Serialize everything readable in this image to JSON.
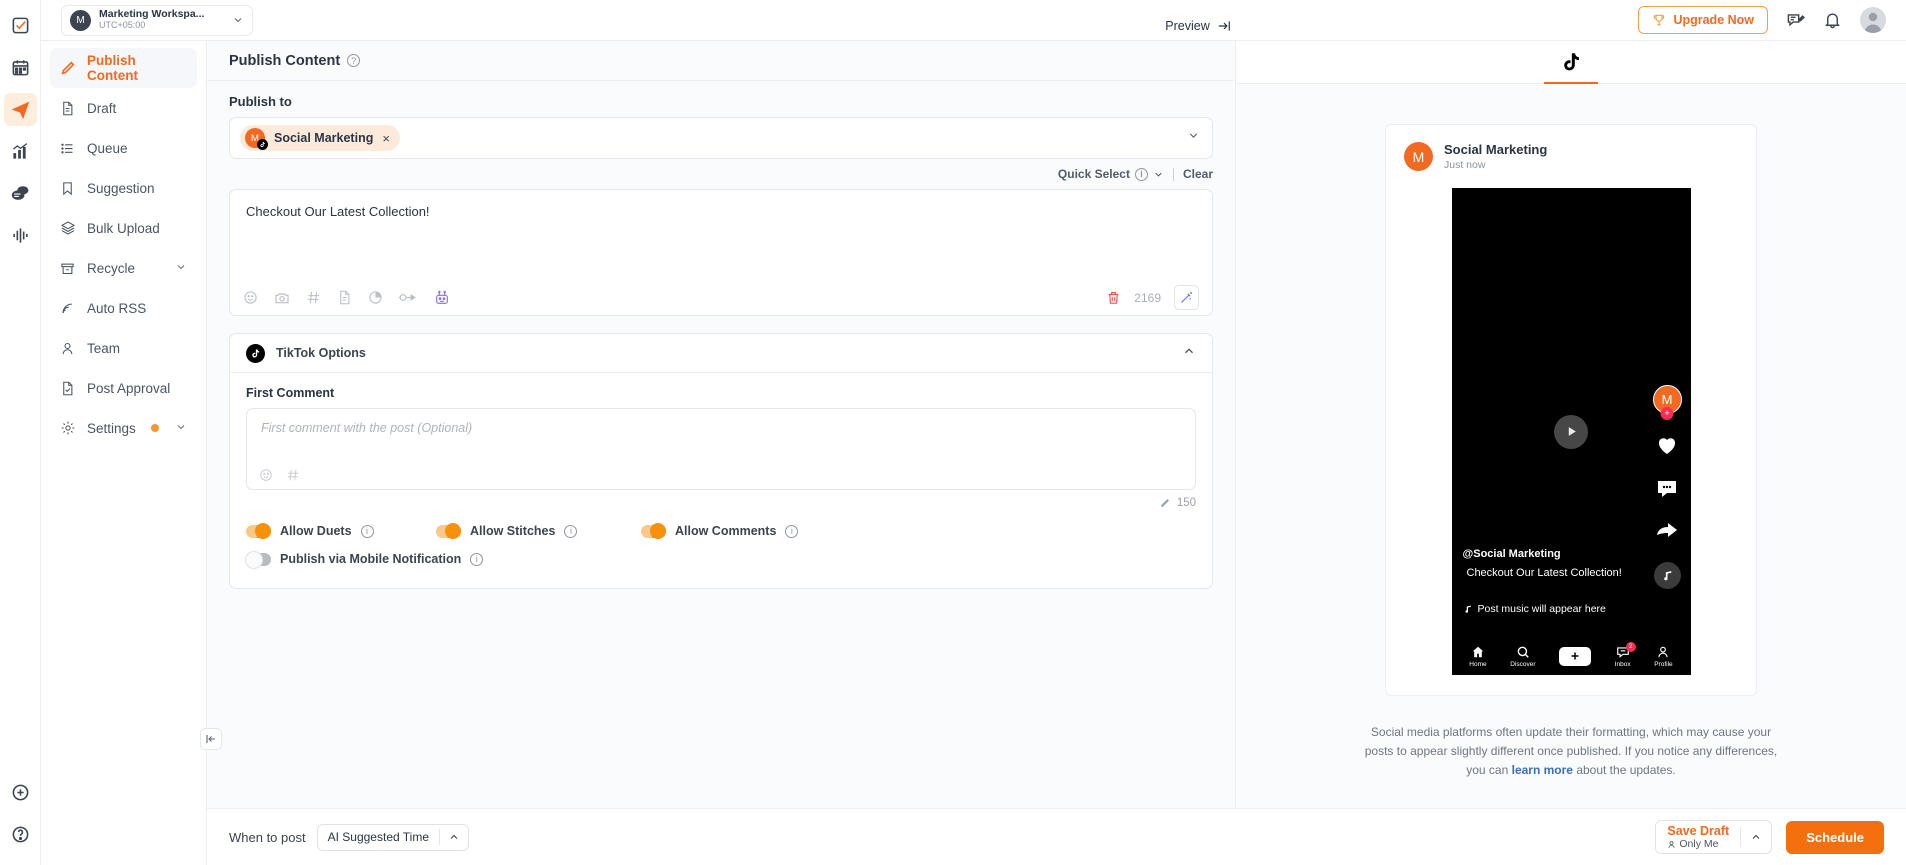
{
  "colors": {
    "accent": "#f26a21",
    "accent_button": "#f4700f",
    "toggle_on": "#f7910b",
    "link": "#3b6fb5",
    "tiktok_red": "#fe2c55",
    "tiktok_cyan": "#25f4ee"
  },
  "rail": {
    "items": [
      {
        "name": "tasks-icon",
        "label": "Tasks",
        "active": false
      },
      {
        "name": "calendar-icon",
        "label": "Calendar",
        "active": false
      },
      {
        "name": "publish-icon",
        "label": "Publish",
        "active": true
      },
      {
        "name": "analytics-icon",
        "label": "Analytics",
        "active": false
      },
      {
        "name": "engage-icon",
        "label": "Engage",
        "active": false
      },
      {
        "name": "listening-icon",
        "label": "Listening",
        "active": false
      }
    ],
    "bottom": [
      {
        "name": "add-icon",
        "label": "Add"
      },
      {
        "name": "help-icon",
        "label": "Help"
      }
    ]
  },
  "topbar": {
    "workspace": {
      "avatar_initial": "M",
      "name": "Marketing Workspa...",
      "timezone": "UTC+05:00"
    },
    "upgrade_label": "Upgrade Now",
    "icons": [
      "trophy-icon",
      "feedback-icon",
      "notification-bell-icon",
      "user-avatar"
    ]
  },
  "sidebar": {
    "items": [
      {
        "label": "Publish Content",
        "icon": "pencil-icon",
        "active": true,
        "chevron": false,
        "badge": false
      },
      {
        "label": "Draft",
        "icon": "document-icon",
        "active": false,
        "chevron": false,
        "badge": false
      },
      {
        "label": "Queue",
        "icon": "list-icon",
        "active": false,
        "chevron": false,
        "badge": false
      },
      {
        "label": "Suggestion",
        "icon": "bookmark-icon",
        "active": false,
        "chevron": false,
        "badge": false
      },
      {
        "label": "Bulk Upload",
        "icon": "layers-icon",
        "active": false,
        "chevron": false,
        "badge": false
      },
      {
        "label": "Recycle",
        "icon": "archive-icon",
        "active": false,
        "chevron": true,
        "badge": false
      },
      {
        "label": "Auto RSS",
        "icon": "rss-icon",
        "active": false,
        "chevron": false,
        "badge": false
      },
      {
        "label": "Team",
        "icon": "user-icon",
        "active": false,
        "chevron": false,
        "badge": false
      },
      {
        "label": "Post Approval",
        "icon": "document-check-icon",
        "active": false,
        "chevron": false,
        "badge": false
      },
      {
        "label": "Settings",
        "icon": "gear-icon",
        "active": false,
        "chevron": true,
        "badge": true
      }
    ]
  },
  "main": {
    "title": "Publish Content",
    "publish_to_label": "Publish to",
    "account_chip": {
      "avatar_initial": "M",
      "name": "Social Marketing",
      "platform": "tiktok",
      "remove": "×"
    },
    "quick_select_label": "Quick Select",
    "clear_label": "Clear",
    "composer": {
      "text": "Checkout Our Latest Collection!",
      "char_count": "2169",
      "toolbar_icons": [
        "emoji-icon",
        "camera-icon",
        "hashtag-icon",
        "document-icon",
        "poll-icon",
        "link-plug-icon",
        "ai-robot-icon"
      ],
      "delete_icon": "trash-icon",
      "wand_icon": "magic-wand-icon"
    },
    "options": {
      "title": "TikTok Options",
      "first_comment_label": "First Comment",
      "first_comment_placeholder": "First comment with the post (Optional)",
      "first_comment_value": "",
      "first_comment_icons": [
        "emoji-icon",
        "hashtag-icon"
      ],
      "first_comment_count": "150",
      "toggles": [
        {
          "label": "Allow Duets",
          "on": true
        },
        {
          "label": "Allow Stitches",
          "on": true
        },
        {
          "label": "Allow Comments",
          "on": true
        },
        {
          "label": "Publish via Mobile Notification",
          "on": false
        }
      ]
    }
  },
  "preview": {
    "tab_label": "Preview",
    "platform_tab": "tiktok",
    "card": {
      "avatar_initial": "M",
      "account_name": "Social Marketing",
      "timestamp": "Just now"
    },
    "phone": {
      "handle": "@Social Marketing",
      "caption": "Checkout Our Latest Collection!",
      "music_text": "Post music will appear here",
      "side_avatar_initial": "M",
      "nav": [
        {
          "label": "Home",
          "icon": "home-icon",
          "badge": ""
        },
        {
          "label": "Discover",
          "icon": "search-icon",
          "badge": ""
        },
        {
          "label": "",
          "icon": "plus-icon",
          "badge": ""
        },
        {
          "label": "Inbox",
          "icon": "inbox-icon",
          "badge": "2"
        },
        {
          "label": "Profile",
          "icon": "profile-icon",
          "badge": ""
        }
      ]
    },
    "disclaimer": {
      "line1": "Social media platforms often update their formatting, which may cause your",
      "line2": "posts to appear slightly different once published.",
      "line3_pre": "If you notice any differences, you can ",
      "link": "learn more",
      "line3_post": " about the updates."
    }
  },
  "bottombar": {
    "when_to_post_label": "When to post",
    "schedule_option": "AI Suggested Time",
    "save_draft_label": "Save Draft",
    "save_draft_sub": "Only Me",
    "schedule_button": "Schedule"
  }
}
